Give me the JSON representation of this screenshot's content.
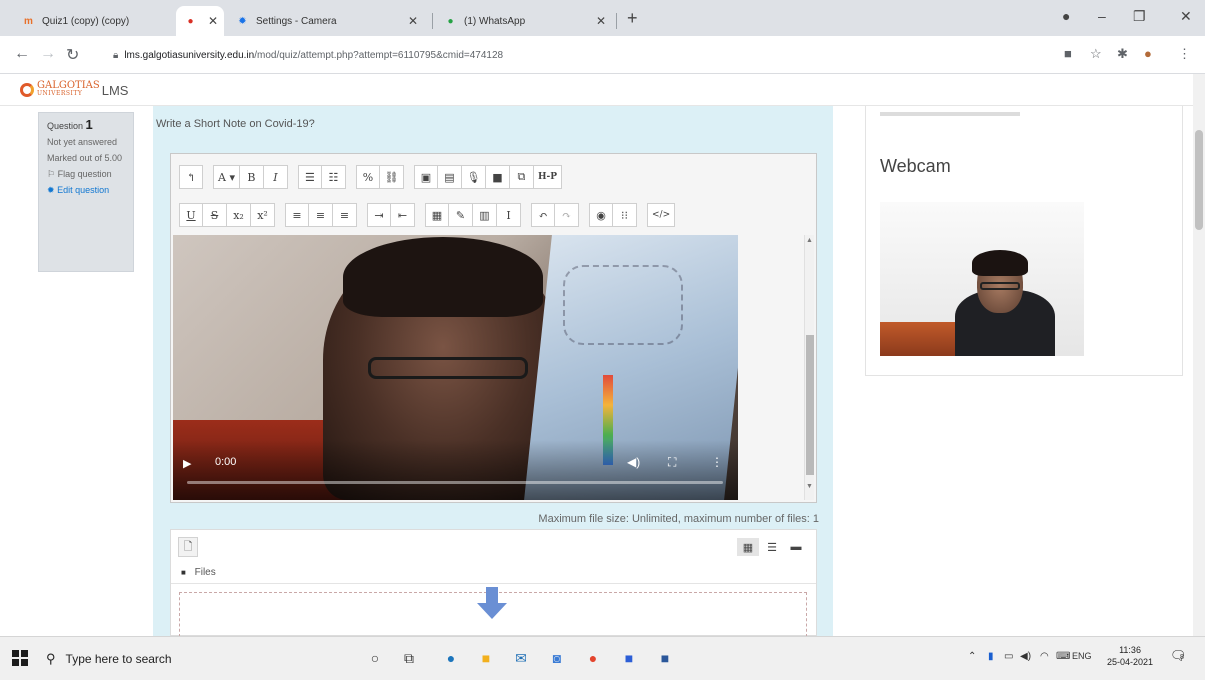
{
  "browser": {
    "tabs": [
      {
        "title": "Quiz1 (copy) (copy)",
        "icon": "moodle-icon"
      },
      {
        "title": "Settings - Camera",
        "icon": "gear-icon"
      },
      {
        "title": "(1) WhatsApp",
        "icon": "whatsapp-icon"
      }
    ],
    "new_tab": "+",
    "url_host": "lms.galgotiasuniversity.edu.in",
    "url_path": "/mod/quiz/attempt.php?attempt=6110795&cmid=474128"
  },
  "lms": {
    "logo_text": "GALGOTIAS",
    "logo_sub": "UNIVERSITY",
    "logo_suffix": "LMS"
  },
  "question_info": {
    "label": "Question",
    "number": "1",
    "status": "Not yet answered",
    "marks": "Marked out of 5.00",
    "flag": "Flag question",
    "edit": "Edit question"
  },
  "question": {
    "text": "Write a Short Note on Covid-19?"
  },
  "editor": {
    "row1": [
      "↰",
      "A ▾",
      "B",
      "I",
      "☰",
      "☷",
      "%",
      "⛓",
      "▣",
      "▤",
      "🎙",
      "■",
      "⧉",
      "H-P"
    ],
    "row2": [
      "U",
      "S",
      "x₂",
      "x²",
      "≡",
      "≡",
      "≡",
      "⇥",
      "⇤",
      "▦",
      "✎",
      "▥",
      "I",
      "↶",
      "↷",
      "◉",
      "⁝⁝",
      "</>"
    ]
  },
  "video": {
    "time": "0:00",
    "progress": 0
  },
  "filemanager": {
    "max_size": "Maximum file size: Unlimited, maximum number of files: 1",
    "path_label": "Files"
  },
  "sidebar": {
    "webcam_title": "Webcam"
  },
  "taskbar": {
    "search_placeholder": "Type here to search",
    "lang": "ENG",
    "time": "11:36",
    "date": "25-04-2021",
    "notifications": "8"
  }
}
